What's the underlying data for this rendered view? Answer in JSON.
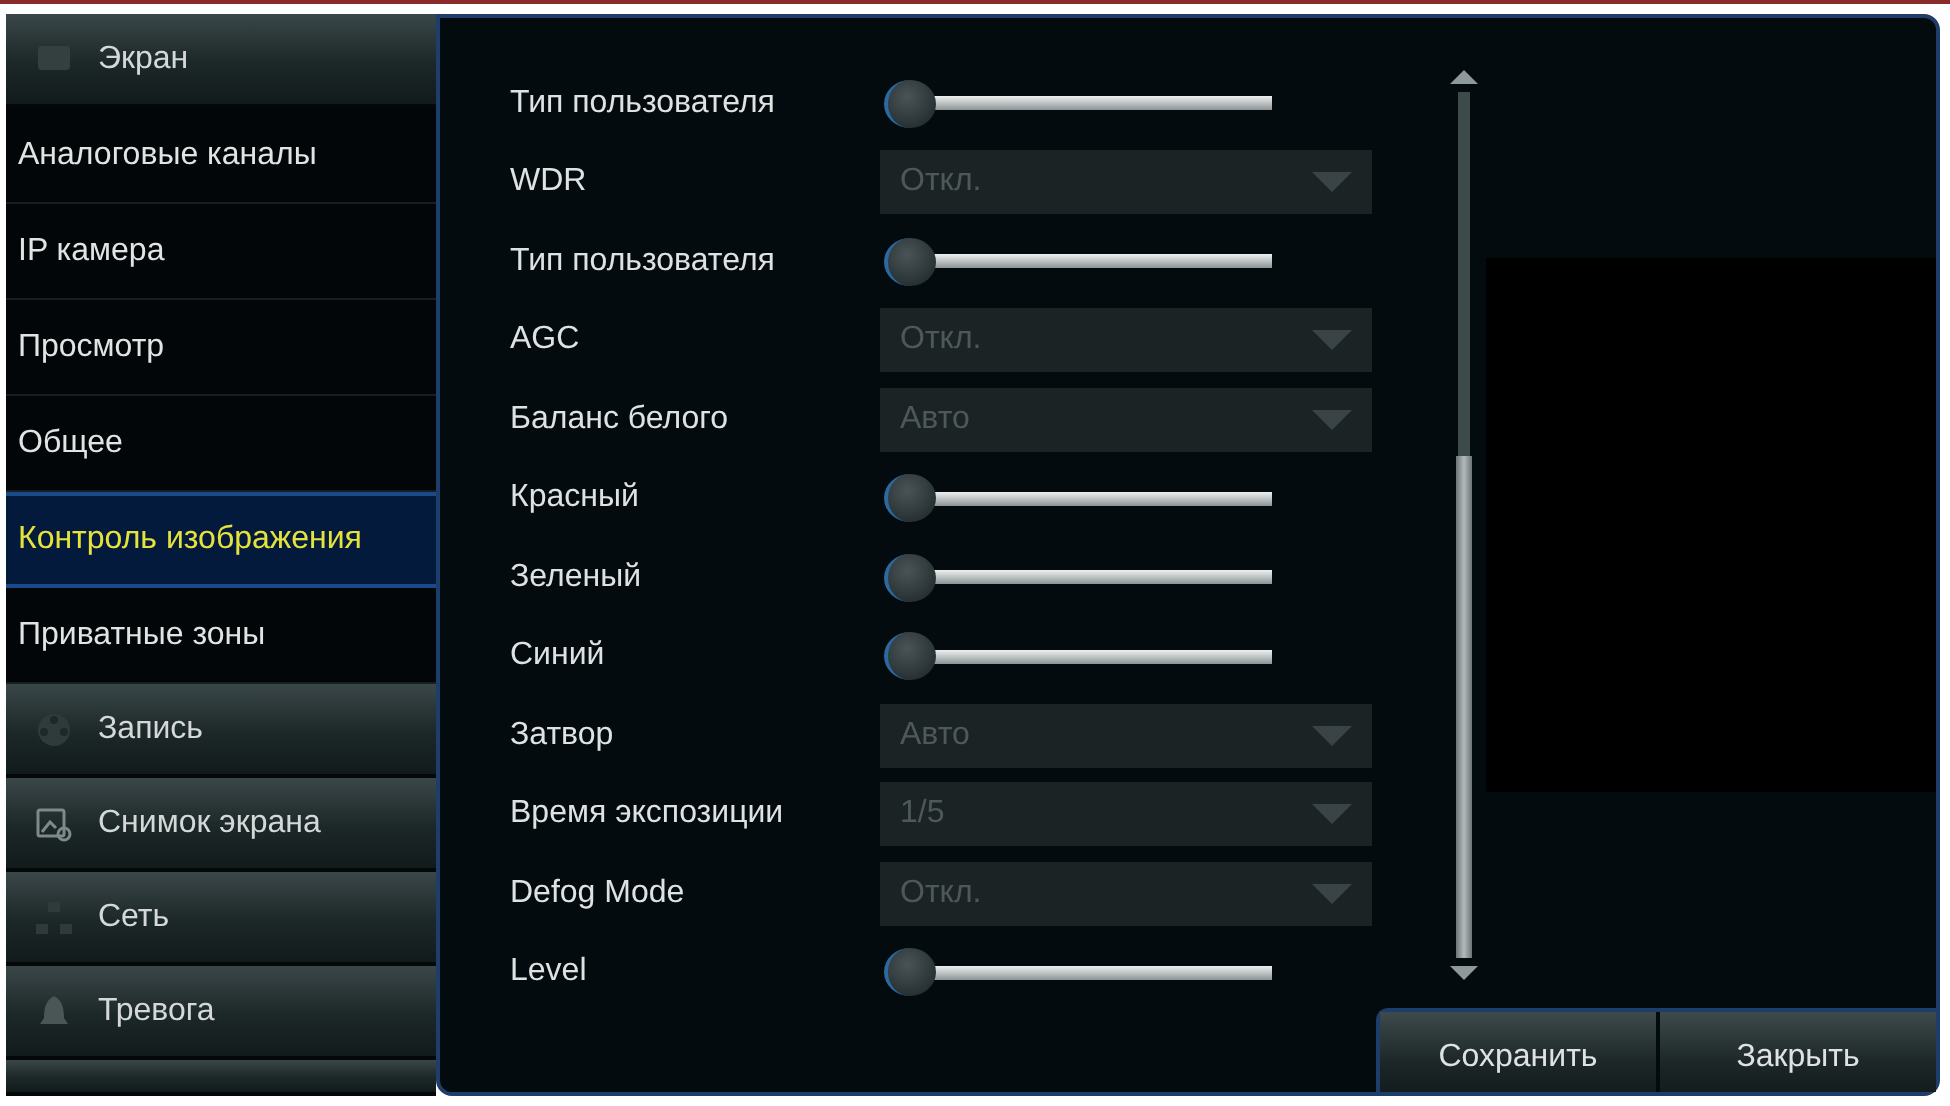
{
  "sidebar": {
    "items": [
      {
        "kind": "category",
        "label": "Экран",
        "selected": false
      },
      {
        "kind": "item",
        "label": "Аналоговые каналы",
        "selected": false
      },
      {
        "kind": "item",
        "label": "IP камера",
        "selected": false
      },
      {
        "kind": "item",
        "label": "Просмотр",
        "selected": false
      },
      {
        "kind": "item",
        "label": "Общее",
        "selected": false
      },
      {
        "kind": "item",
        "label": "Контроль изображения",
        "selected": true
      },
      {
        "kind": "item",
        "label": "Приватные зоны",
        "selected": false
      },
      {
        "kind": "category",
        "label": "Запись",
        "selected": false
      },
      {
        "kind": "category",
        "label": "Снимок экрана",
        "selected": false
      },
      {
        "kind": "category",
        "label": "Сеть",
        "selected": false
      },
      {
        "kind": "category",
        "label": "Тревога",
        "selected": false
      }
    ]
  },
  "settings": [
    {
      "kind": "slider",
      "label": "Тип пользователя",
      "level": 0
    },
    {
      "kind": "dropdown",
      "label": "WDR",
      "value": "Откл."
    },
    {
      "kind": "slider",
      "label": "Тип пользователя",
      "level": 0
    },
    {
      "kind": "dropdown",
      "label": "AGC",
      "value": "Откл."
    },
    {
      "kind": "dropdown",
      "label": "Баланс белого",
      "value": "Авто"
    },
    {
      "kind": "slider",
      "label": "Красный",
      "level": 0
    },
    {
      "kind": "slider",
      "label": "Зеленый",
      "level": 0
    },
    {
      "kind": "slider",
      "label": "Синий",
      "level": 0
    },
    {
      "kind": "dropdown",
      "label": "Затвор",
      "value": "Авто"
    },
    {
      "kind": "dropdown",
      "label": "Время экспозиции",
      "value": "1/5"
    },
    {
      "kind": "dropdown",
      "label": "Defog Mode",
      "value": "Откл."
    },
    {
      "kind": "slider",
      "label": "Level",
      "level": 0
    }
  ],
  "buttons": [
    "Сохранить",
    "Закрыть"
  ]
}
